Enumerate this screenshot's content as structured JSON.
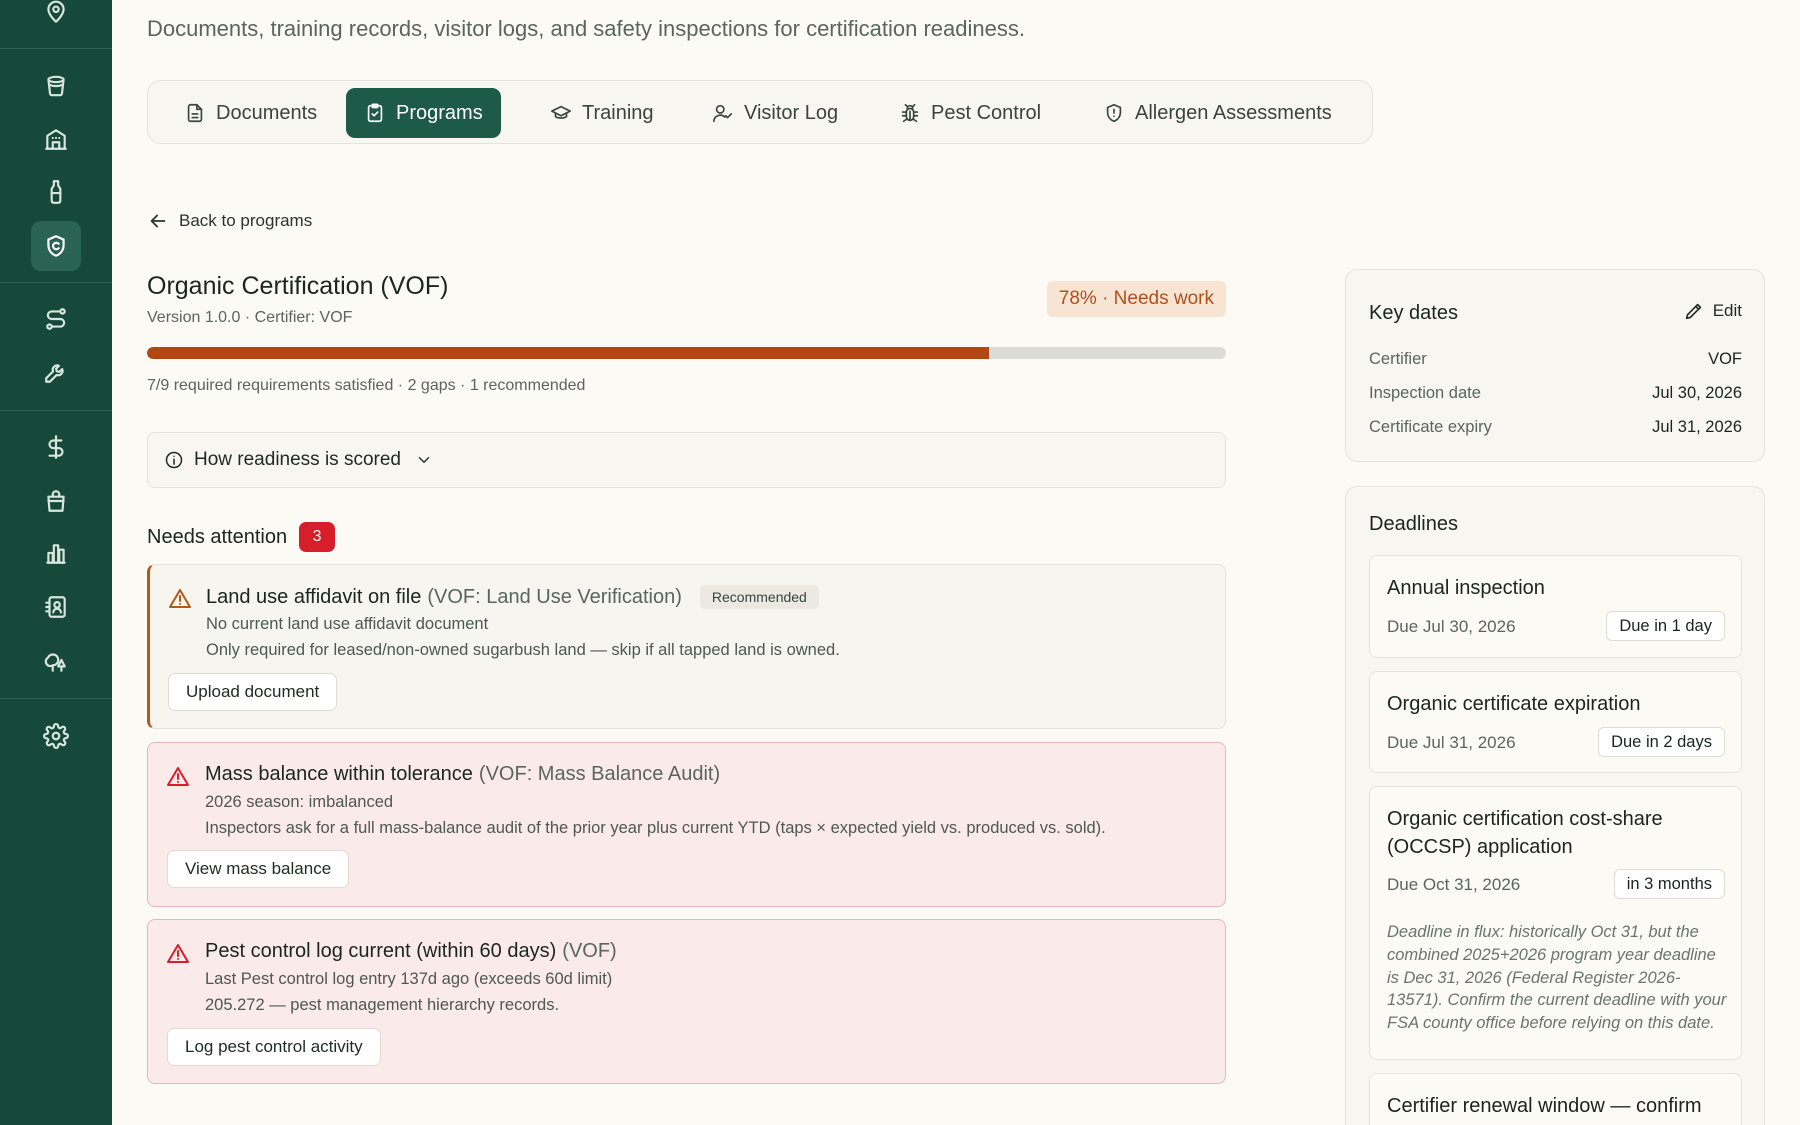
{
  "header": {
    "subtitle": "Documents, training records, visitor logs, and safety inspections for certification readiness."
  },
  "sidebar": {
    "icons": [
      "location-icon",
      "bucket-icon",
      "building-icon",
      "bottle-icon",
      "shield-icon",
      "route-icon",
      "wrench-icon",
      "dollar-icon",
      "shopping-bag-icon",
      "bar-chart-icon",
      "contacts-icon",
      "trees-icon",
      "gear-icon"
    ],
    "active": "shield-icon"
  },
  "tabs": [
    {
      "label": "Documents",
      "icon": "file-icon"
    },
    {
      "label": "Programs",
      "icon": "clipboard-check-icon",
      "active": true
    },
    {
      "label": "Training",
      "icon": "graduation-cap-icon"
    },
    {
      "label": "Visitor Log",
      "icon": "user-check-icon"
    },
    {
      "label": "Pest Control",
      "icon": "bug-icon"
    },
    {
      "label": "Allergen Assessments",
      "icon": "shield-alert-icon"
    }
  ],
  "program": {
    "back_label": "Back to programs",
    "title": "Organic Certification (VOF)",
    "meta": "Version 1.0.0 · Certifier: VOF",
    "score_label": "78% · Needs work",
    "progress_fraction": 0.78,
    "progress_color": "#b24712",
    "summary": "7/9 required requirements satisfied · 2 gaps · 1 recommended",
    "how_scored_label": "How readiness is scored"
  },
  "attention": {
    "heading": "Needs attention",
    "count": "3",
    "items": [
      {
        "severity": "warning",
        "title": "Land use affidavit on file",
        "source": "(VOF: Land Use Verification)",
        "tag": "Recommended",
        "line1": "No current land use affidavit document",
        "line2": "Only required for leased/non-owned sugarbush land — skip if all tapped land is owned.",
        "action": "Upload document"
      },
      {
        "severity": "error",
        "title": "Mass balance within tolerance",
        "source": "(VOF: Mass Balance Audit)",
        "line1": "2026 season: imbalanced",
        "line2": "Inspectors ask for a full mass-balance audit of the prior year plus current YTD (taps × expected yield vs. produced vs. sold).",
        "action": "View mass balance"
      },
      {
        "severity": "error",
        "title": "Pest control log current (within 60 days)",
        "source": "(VOF)",
        "line1": "Last Pest control log entry 137d ago (exceeds 60d limit)",
        "line2": "205.272 — pest management hierarchy records.",
        "action": "Log pest control activity"
      }
    ]
  },
  "key_dates": {
    "heading": "Key dates",
    "edit_label": "Edit",
    "rows": [
      {
        "label": "Certifier",
        "value": "VOF"
      },
      {
        "label": "Inspection date",
        "value": "Jul 30, 2026"
      },
      {
        "label": "Certificate expiry",
        "value": "Jul 31, 2026"
      }
    ]
  },
  "deadlines": {
    "heading": "Deadlines",
    "items": [
      {
        "title": "Annual inspection",
        "due": "Due Jul 30, 2026",
        "pill": "Due in 1 day"
      },
      {
        "title": "Organic certificate expiration",
        "due": "Due Jul 31, 2026",
        "pill": "Due in 2 days"
      },
      {
        "title": "Organic certification cost-share (OCCSP) application",
        "due": "Due Oct 31, 2026",
        "pill": "in 3 months",
        "note": "Deadline in flux: historically Oct 31, but the combined 2025+2026 program year deadline is Dec 31, 2026 (Federal Register 2026-13571). Confirm the current deadline with your FSA county office before relying on this date."
      },
      {
        "title": "Certifier renewal window — confirm"
      }
    ]
  }
}
